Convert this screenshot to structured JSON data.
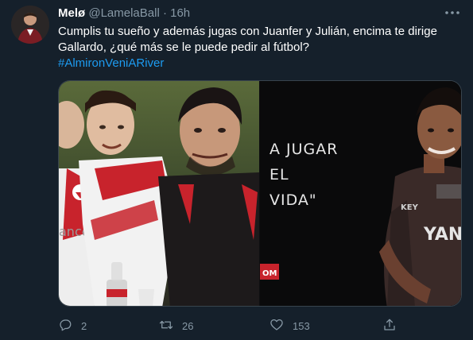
{
  "tweet": {
    "author_name": "Melø",
    "handle": "@LamelaBall",
    "separator": "·",
    "time": "16h",
    "text_line1": "Cumplis tu sueño y además jugas con Juanfer y Julián, encima te dirige",
    "text_line2": "Gallardo, ¿qué más se le puede pedir al fútbol?",
    "hashtag": "#AlmironVeniARiver",
    "more_icon": "ellipsis-icon"
  },
  "media": {
    "overlay_line1": "A JUGAR",
    "overlay_line2": "EL",
    "overlay_line3": "VIDA\"",
    "shirt_text_left": "ancés",
    "shirt_text_right": "YAN",
    "red_tag": "OM",
    "kit_sponsor": "KEY"
  },
  "actions": {
    "reply_count": "2",
    "retweet_count": "26",
    "like_count": "153",
    "reply_icon": "reply-icon",
    "retweet_icon": "retweet-icon",
    "like_icon": "heart-icon",
    "share_icon": "share-icon"
  },
  "colors": {
    "background": "#15202b",
    "text_primary": "#ffffff",
    "text_secondary": "#8899a6",
    "link": "#1d9bf0",
    "border": "#38444d"
  }
}
